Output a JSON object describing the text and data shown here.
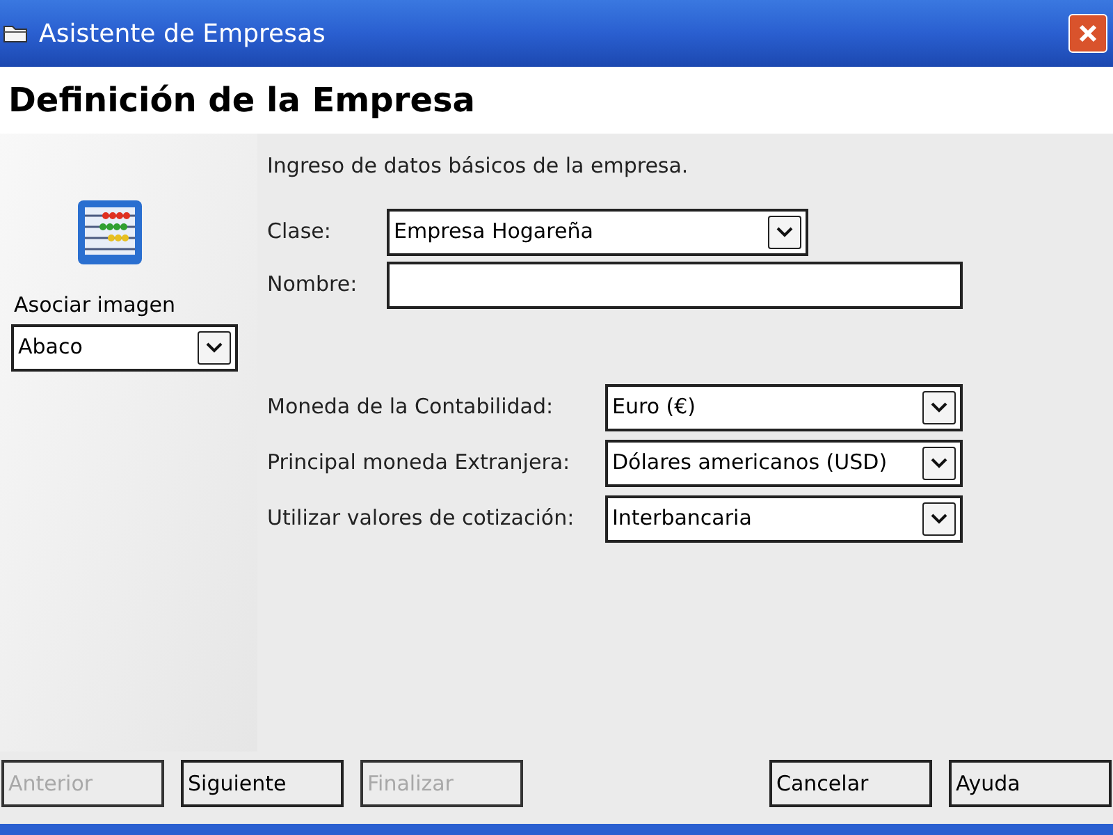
{
  "window": {
    "title": "Asistente de Empresas"
  },
  "heading": "Definición de la Empresa",
  "image_panel": {
    "label": "Asociar imagen",
    "dropdown": {
      "value": "Abaco"
    }
  },
  "intro": "Ingreso de datos básicos de la empresa.",
  "top_fields": [
    {
      "kind": "dropdown",
      "label": "Clase:",
      "value": "Empresa Hogareña"
    },
    {
      "kind": "text",
      "label": "Nombre:"
    }
  ],
  "currency_fields": [
    {
      "kind": "dropdown",
      "label": "Moneda de la Contabilidad:",
      "value": "Euro (€)"
    },
    {
      "kind": "dropdown",
      "label": "Principal moneda Extranjera:",
      "value": "Dólares americanos (USD)"
    },
    {
      "kind": "dropdown",
      "label": "Utilizar valores de cotización:",
      "value": "Interbancaria"
    }
  ],
  "buttons_left": [
    {
      "label": "Anterior",
      "disabled": true
    },
    {
      "label": "Siguiente",
      "disabled": false
    },
    {
      "label": "Finalizar",
      "disabled": true
    }
  ],
  "buttons_right": [
    {
      "label": "Cancelar",
      "disabled": false
    },
    {
      "label": "Ayuda",
      "disabled": false
    }
  ]
}
